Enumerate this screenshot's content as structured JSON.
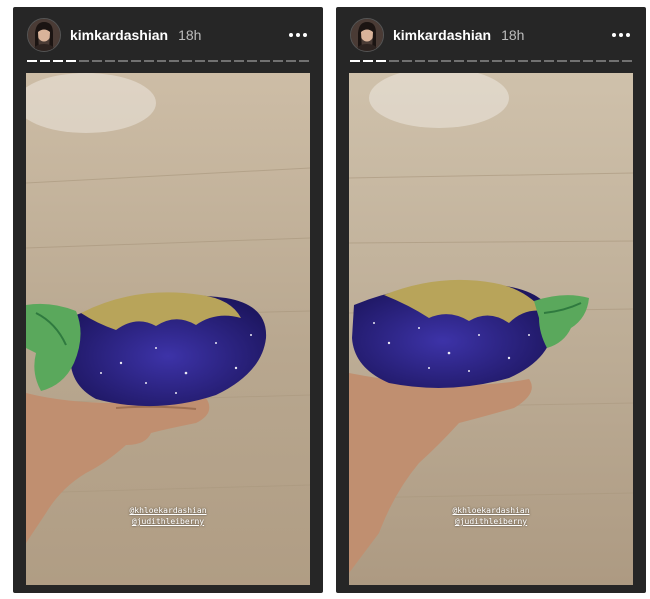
{
  "stories": [
    {
      "username": "kimkardashian",
      "time": "18h",
      "segments_total": 22,
      "segments_viewed": 4,
      "mentions": [
        "@khloekardashian",
        "@judithleiberny"
      ]
    },
    {
      "username": "kimkardashian",
      "time": "18h",
      "segments_total": 22,
      "segments_viewed": 3,
      "mentions": [
        "@khloekardashian",
        "@judithleiberny"
      ]
    }
  ],
  "icons": {
    "more": "more-horizontal-icon"
  },
  "colors": {
    "story_bg": "#262626",
    "progress_viewed": "#ffffff",
    "progress_pending": "#6b6b6b",
    "floor": "#b9a994",
    "clutch_body": "#2a1f7a",
    "clutch_leaf": "#58a85a"
  }
}
